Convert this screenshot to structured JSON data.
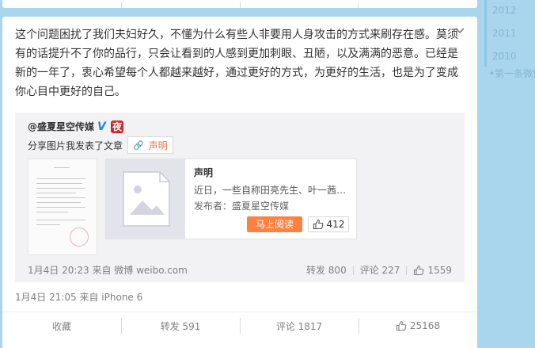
{
  "post": {
    "text": "这个问题困扰了我们夫妇好久，不懂为什么有些人非要用人身攻击的方式来刷存在感。莫须有的话提升不了你的品行，只会让看到的人感到更加刺眼、丑陋，以及满满的恶意。已经是新的一年了，衷心希望每个人都越来越好，通过更好的方式，为更好的生活，也是为了变成你心目中更好的自己。",
    "time_source": "1月4日 21:05 来自 iPhone 6"
  },
  "repost": {
    "author": "@盛夏星空传媒",
    "verified_badge": "V",
    "night_badge": "夜",
    "share_line": "分享图片我发表了文章",
    "tag": "声明",
    "article": {
      "title": "声明",
      "desc": "近日，一些自称田亮先生、叶一茜…",
      "publisher": "发布者：盛夏星空传媒",
      "read_button": "马上阅读",
      "likes": "412"
    },
    "time_source": "1月4日 20:23 来自 微博 weibo.com",
    "forward": "转发 800",
    "comment": "评论 227",
    "like": "1559"
  },
  "actions": {
    "favorite": "收藏",
    "forward": "转发 591",
    "comment": "评论 1817",
    "like": "25168"
  },
  "timeline": {
    "years": [
      "2012",
      "2011",
      "2010"
    ],
    "first_weibo": "第一条微博"
  },
  "colors": {
    "background": "#a9d6ec",
    "accent_orange": "#ff8140",
    "tag_orange": "#eb7350",
    "verified_blue": "#1a8bd6",
    "night_red": "#d6232c"
  }
}
